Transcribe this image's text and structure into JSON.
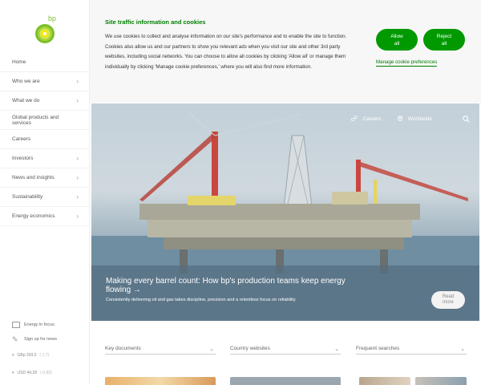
{
  "brand": {
    "logo_text": "bp",
    "accent": "#009900",
    "logo_green": "#7dbf2a",
    "logo_yellow": "#ffe600"
  },
  "sidebar": {
    "items": [
      {
        "label": "Home",
        "has_children": false
      },
      {
        "label": "Who we are",
        "has_children": true
      },
      {
        "label": "What we do",
        "has_children": true
      },
      {
        "label": "Global products and services",
        "has_children": false
      },
      {
        "label": "Careers",
        "has_children": false
      },
      {
        "label": "Investors",
        "has_children": true
      },
      {
        "label": "News and insights",
        "has_children": true
      },
      {
        "label": "Sustainability",
        "has_children": true
      },
      {
        "label": "Energy economics",
        "has_children": true
      }
    ],
    "links": [
      {
        "label": "Energy in focus",
        "icon": "book-icon"
      },
      {
        "label": "Sign up for news",
        "icon": "pen-icon"
      }
    ],
    "tickers": [
      {
        "label": "GBp 393.0",
        "change": "(-1.7)"
      },
      {
        "label": "USD 44.28",
        "change": "(-0.80)"
      }
    ]
  },
  "cookie": {
    "title": "Site traffic information and cookies",
    "body": "We use cookies to collect and analyse information on our site's performance and to enable the site to function. Cookies also allow us and our partners to show you relevant ads when you visit our site and other 3rd party websites, including social networks. You can choose to allow all cookies by clicking 'Allow all' or manage them individually by clicking 'Manage cookie preferences,' where you will also find more information.",
    "allow_label": "Allow all",
    "reject_label": "Reject all",
    "manage_label": "Manage cookie preferences"
  },
  "topnav": {
    "careers": "Careers",
    "worldwide": "Worldwide"
  },
  "hero": {
    "title": "Making every barrel count: How bp's production teams keep energy flowing",
    "arrow": "→",
    "subtitle": "Consistently delivering oil and gas takes discipline, precision and a relentless focus on reliability",
    "read_more": "Read more"
  },
  "dropdowns": [
    {
      "label": "Key documents"
    },
    {
      "label": "Country websites"
    },
    {
      "label": "Frequent searches"
    }
  ]
}
